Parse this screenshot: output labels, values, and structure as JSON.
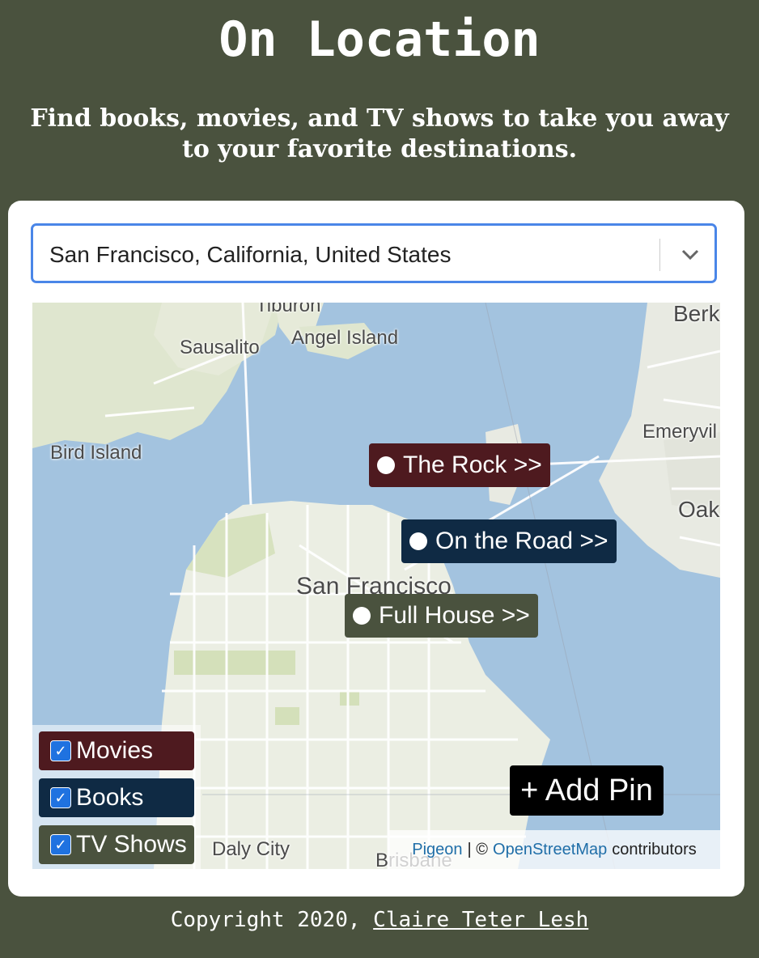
{
  "header": {
    "title": "On Location",
    "subtitle": "Find books, movies, and TV shows to take you away to your favorite destinations."
  },
  "location_select": {
    "value": "San Francisco, California, United States"
  },
  "map": {
    "labels": {
      "tiburon": "Tiburon",
      "angel_island": "Angel Island",
      "sausalito": "Sausalito",
      "berkeley": "Berk",
      "emeryville": "Emeryvil",
      "bird_island": "Bird Island",
      "oakland": "Oak",
      "san_francisco": "San Francisco",
      "daly_city": "Daly City",
      "brisbane": "Brisbane"
    },
    "pins": [
      {
        "label": "The Rock >>",
        "category": "Movies",
        "color": "#4e1a1f"
      },
      {
        "label": "On the Road >>",
        "category": "Books",
        "color": "#0f2a44"
      },
      {
        "label": "Full House >>",
        "category": "TV Shows",
        "color": "#4a523e"
      }
    ],
    "legend": [
      {
        "label": "Movies",
        "checked": true,
        "color": "#4e1a1f"
      },
      {
        "label": "Books",
        "checked": true,
        "color": "#0f2a44"
      },
      {
        "label": "TV Shows",
        "checked": true,
        "color": "#4a523e"
      }
    ],
    "add_pin_label": "+ Add Pin",
    "attribution": {
      "pigeon": "Pigeon",
      "separator": "| ©",
      "osm": "OpenStreetMap",
      "contributors": "contributors"
    }
  },
  "footer": {
    "prefix": "Copyright 2020,",
    "author": "Claire Teter Lesh"
  },
  "colors": {
    "background": "#4a523e",
    "select_border": "#4a86e8",
    "water": "#a3c3df",
    "land": "#e9ede0"
  }
}
